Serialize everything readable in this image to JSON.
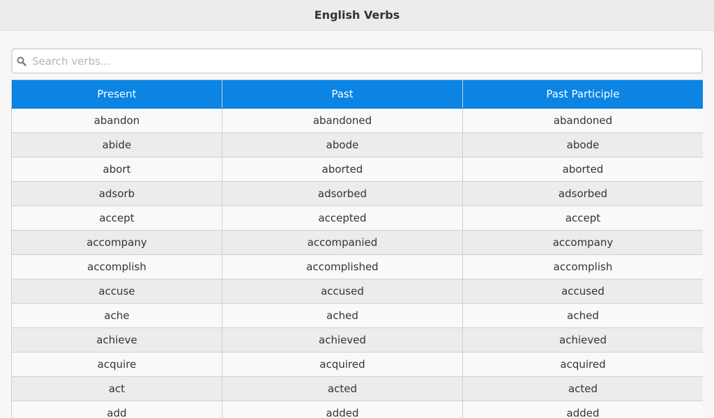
{
  "header": {
    "title": "English Verbs"
  },
  "search": {
    "placeholder": "Search verbs...",
    "value": "",
    "icon": "search-icon"
  },
  "table": {
    "columns": [
      "Present",
      "Past",
      "Past Participle"
    ],
    "rows": [
      [
        "abandon",
        "abandoned",
        "abandoned"
      ],
      [
        "abide",
        "abode",
        "abode"
      ],
      [
        "abort",
        "aborted",
        "aborted"
      ],
      [
        "adsorb",
        "adsorbed",
        "adsorbed"
      ],
      [
        "accept",
        "accepted",
        "accept"
      ],
      [
        "accompany",
        "accompanied",
        "accompany"
      ],
      [
        "accomplish",
        "accomplished",
        "accomplish"
      ],
      [
        "accuse",
        "accused",
        "accused"
      ],
      [
        "ache",
        "ached",
        "ached"
      ],
      [
        "achieve",
        "achieved",
        "achieved"
      ],
      [
        "acquire",
        "acquired",
        "acquired"
      ],
      [
        "act",
        "acted",
        "acted"
      ],
      [
        "add",
        "added",
        "added"
      ]
    ]
  },
  "colors": {
    "header_bg": "#ececec",
    "table_header_bg": "#0b84e3",
    "row_odd": "#f9f9f9",
    "row_even": "#ececec"
  }
}
